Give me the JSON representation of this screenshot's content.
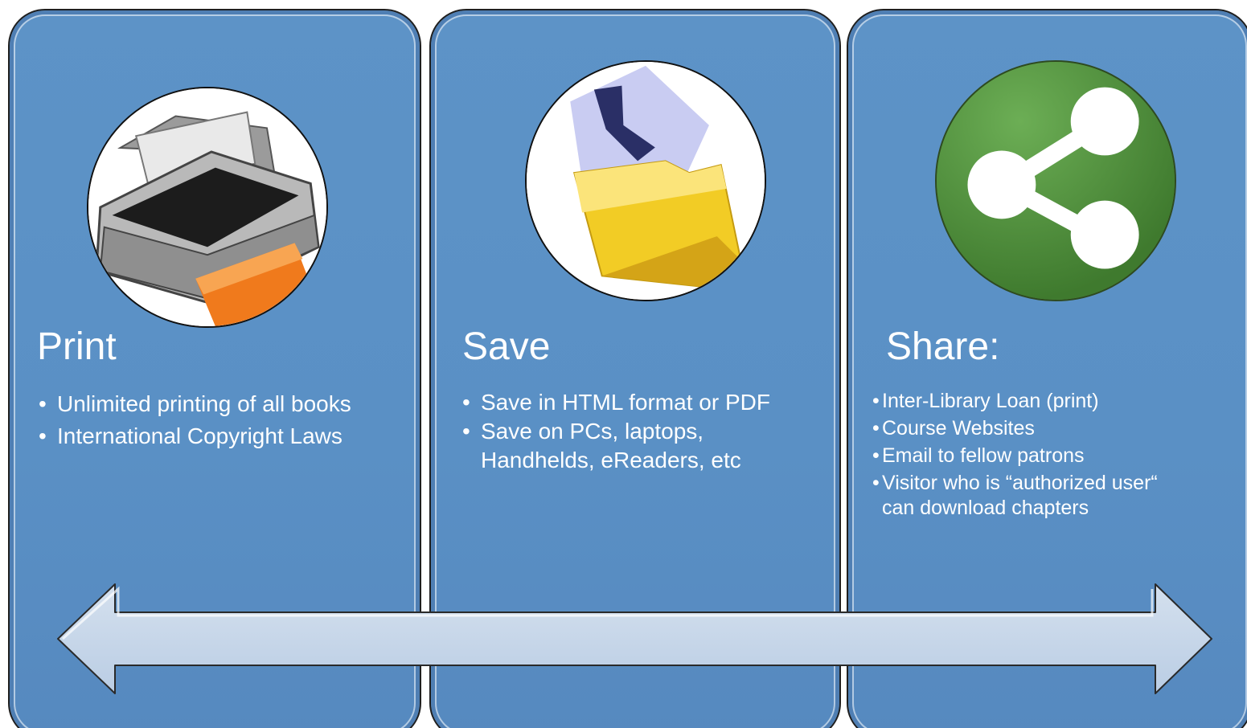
{
  "panels": {
    "print": {
      "title": "Print",
      "bullets": [
        "Unlimited printing of all books",
        "International Copyright Laws"
      ]
    },
    "save": {
      "title": "Save",
      "bullets": [
        "Save in HTML format or PDF",
        "Save on PCs, laptops,",
        "Handhelds, eReaders, etc"
      ]
    },
    "share": {
      "title": "Share:",
      "bullets": [
        "Inter-Library Loan (print)",
        "Course Websites",
        "Email to fellow patrons",
        "Visitor who is “authorized user“",
        "can download chapters"
      ]
    }
  },
  "icons": {
    "print": "printer-icon",
    "save": "save-folder-icon",
    "share": "share-icon"
  },
  "colors": {
    "panel_fill": "#5d93c7",
    "panel_border": "#1f1f1f",
    "arrow_fill": "#c5d5e9",
    "text": "#ffffff",
    "share_green": "#4f8f3c"
  }
}
